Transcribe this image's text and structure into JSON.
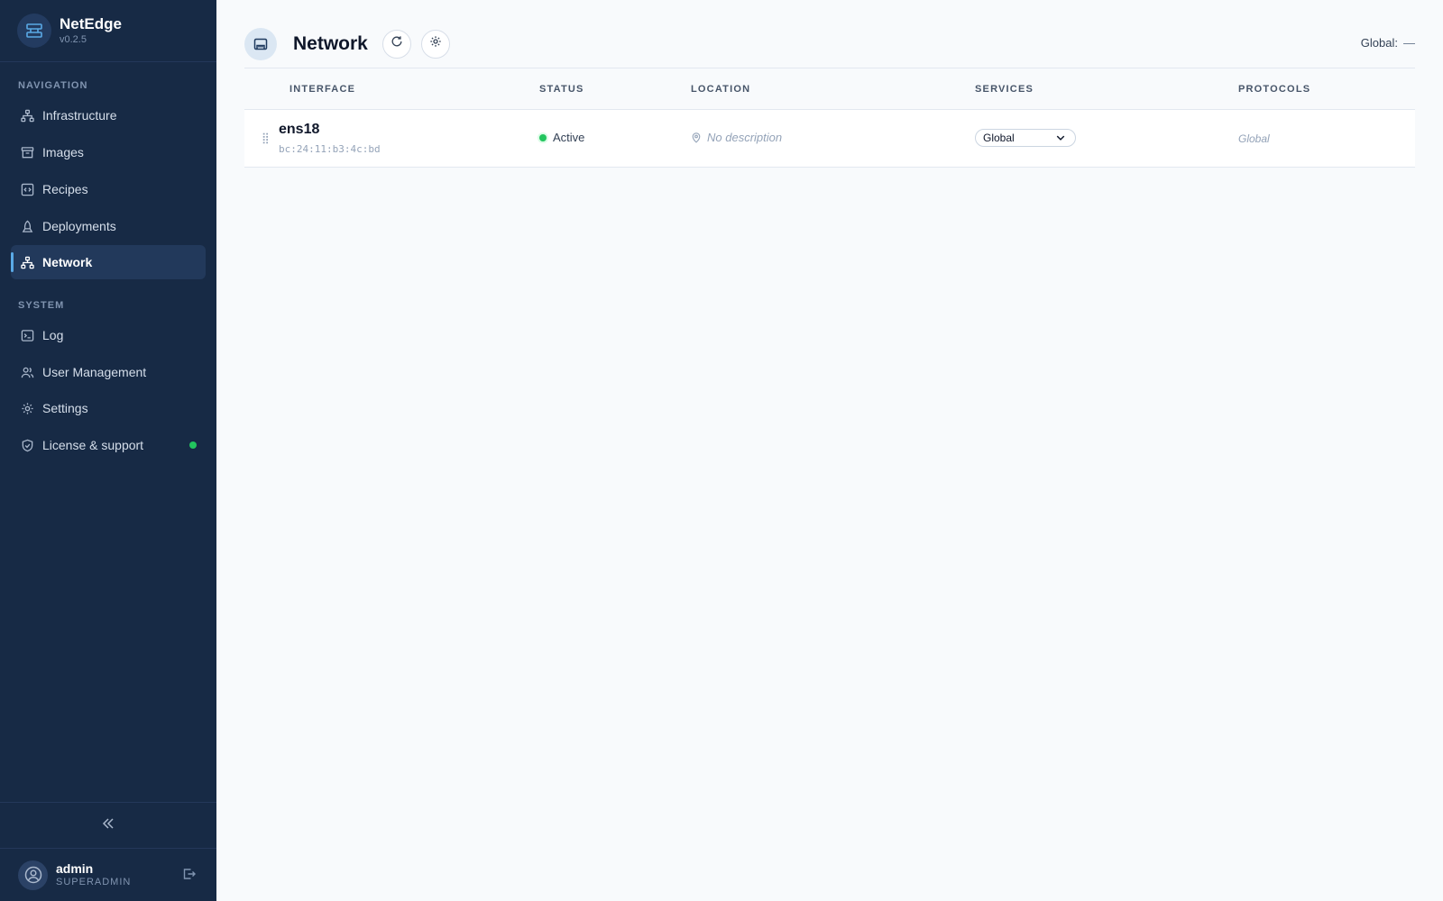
{
  "brand": {
    "name": "NetEdge",
    "version": "v0.2.5",
    "icon": "network-switch-icon"
  },
  "sidebar": {
    "nav_label": "NAVIGATION",
    "nav_items": [
      {
        "label": "Infrastructure",
        "icon": "hierarchy-icon"
      },
      {
        "label": "Images",
        "icon": "archive-icon"
      },
      {
        "label": "Recipes",
        "icon": "code-file-icon"
      },
      {
        "label": "Deployments",
        "icon": "rocket-icon"
      },
      {
        "label": "Network",
        "icon": "network-icon",
        "active": true
      }
    ],
    "system_label": "SYSTEM",
    "system_items": [
      {
        "label": "Log",
        "icon": "terminal-icon"
      },
      {
        "label": "User Management",
        "icon": "users-icon"
      },
      {
        "label": "Settings",
        "icon": "gear-icon"
      },
      {
        "label": "License & support",
        "icon": "shield-check-icon",
        "status_color": "#22c55e"
      }
    ],
    "collapse_icon": "chevrons-left-icon"
  },
  "user": {
    "name": "admin",
    "role": "SUPERADMIN",
    "logout_icon": "logout-icon"
  },
  "header": {
    "title": "Network",
    "page_icon": "ethernet-port-icon",
    "refresh_icon": "refresh-icon",
    "settings_icon": "gear-icon",
    "global_label": "Global:",
    "global_value": "—"
  },
  "table": {
    "columns": [
      "INTERFACE",
      "STATUS",
      "LOCATION",
      "SERVICES",
      "PROTOCOLS"
    ],
    "rows": [
      {
        "name": "ens18",
        "mac": "bc:24:11:b3:4c:bd",
        "status": "Active",
        "status_color": "#22c55e",
        "location": "No description",
        "services": "Global",
        "protocols": "Global"
      }
    ]
  },
  "colors": {
    "sidebar_bg": "#172a45",
    "accent": "#5aa9e6",
    "background": "#f8fafc"
  }
}
